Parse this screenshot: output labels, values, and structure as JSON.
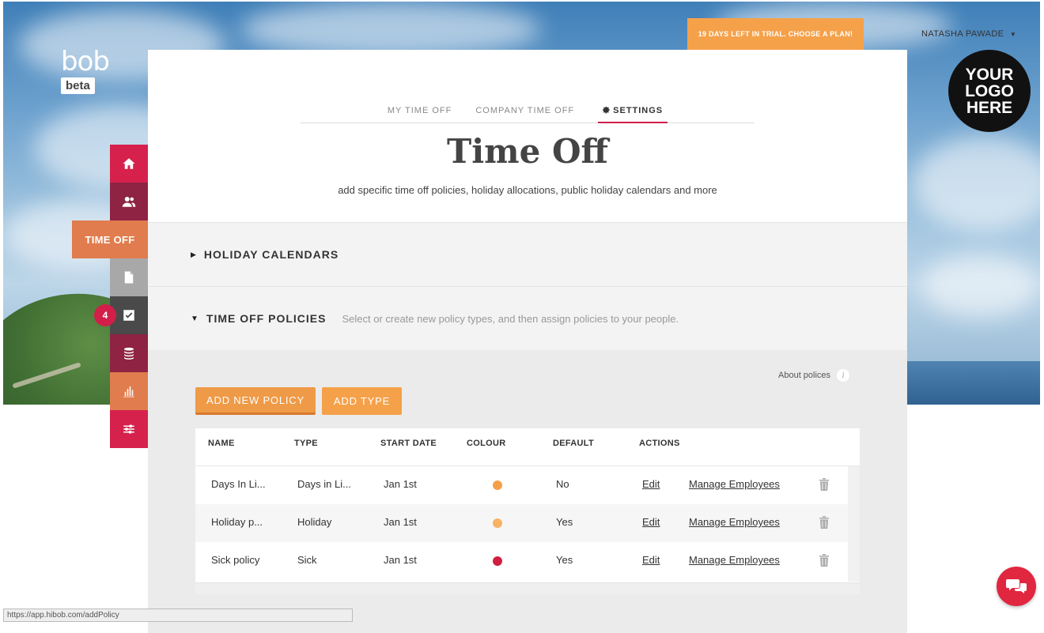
{
  "brand": {
    "name": "bob",
    "badge": "beta"
  },
  "header": {
    "trial_text": "19 DAYS LEFT IN TRIAL. CHOOSE A PLAN!",
    "user_name": "NATASHA PAWADE",
    "user_caret": "▼",
    "logo_lines": [
      "YOUR",
      "LOGO",
      "HERE"
    ]
  },
  "sidenav": {
    "active_label": "TIME OFF",
    "tasks_badge": "4",
    "colors": {
      "home": "#d6214d",
      "people": "#8e2343",
      "active": "#e07c4e",
      "docs": "#a8a8a8",
      "tasks": "#4a4a4a",
      "payroll": "#8e2343",
      "analytics": "#e07c4e",
      "settings": "#d6214d"
    }
  },
  "tabs": [
    {
      "label": "MY TIME OFF"
    },
    {
      "label": "COMPANY TIME OFF"
    },
    {
      "label": "SETTINGS"
    }
  ],
  "page": {
    "title": "Time Off",
    "subtitle": "add specific time off policies, holiday allocations, public holiday calendars and more"
  },
  "sections": {
    "holiday_calendars": {
      "caret": "▶",
      "label": "HOLIDAY CALENDARS"
    },
    "time_off_policies": {
      "caret": "▼",
      "label": "TIME OFF POLICIES",
      "description": "Select or create new policy types, and then assign policies to your people."
    }
  },
  "policies": {
    "about_label": "About polices",
    "about_icon": "i",
    "add_policy_label": "ADD NEW POLICY",
    "add_type_label": "ADD TYPE",
    "columns": [
      "NAME",
      "TYPE",
      "START DATE",
      "COLOUR",
      "DEFAULT",
      "ACTIONS"
    ],
    "rows": [
      {
        "name": "Days In Li...",
        "type": "Days in Li...",
        "start": "Jan 1st",
        "colour": "#f4a049",
        "default": "No",
        "edit": "Edit",
        "manage": "Manage Employees"
      },
      {
        "name": "Holiday p...",
        "type": "Holiday",
        "start": "Jan 1st",
        "colour": "#f8b266",
        "default": "Yes",
        "edit": "Edit",
        "manage": "Manage Employees"
      },
      {
        "name": "Sick policy",
        "type": "Sick",
        "start": "Jan 1st",
        "colour": "#d01f3f",
        "default": "Yes",
        "edit": "Edit",
        "manage": "Manage Employees"
      }
    ]
  },
  "status_bar": {
    "url": "https://app.hibob.com/addPolicy"
  }
}
